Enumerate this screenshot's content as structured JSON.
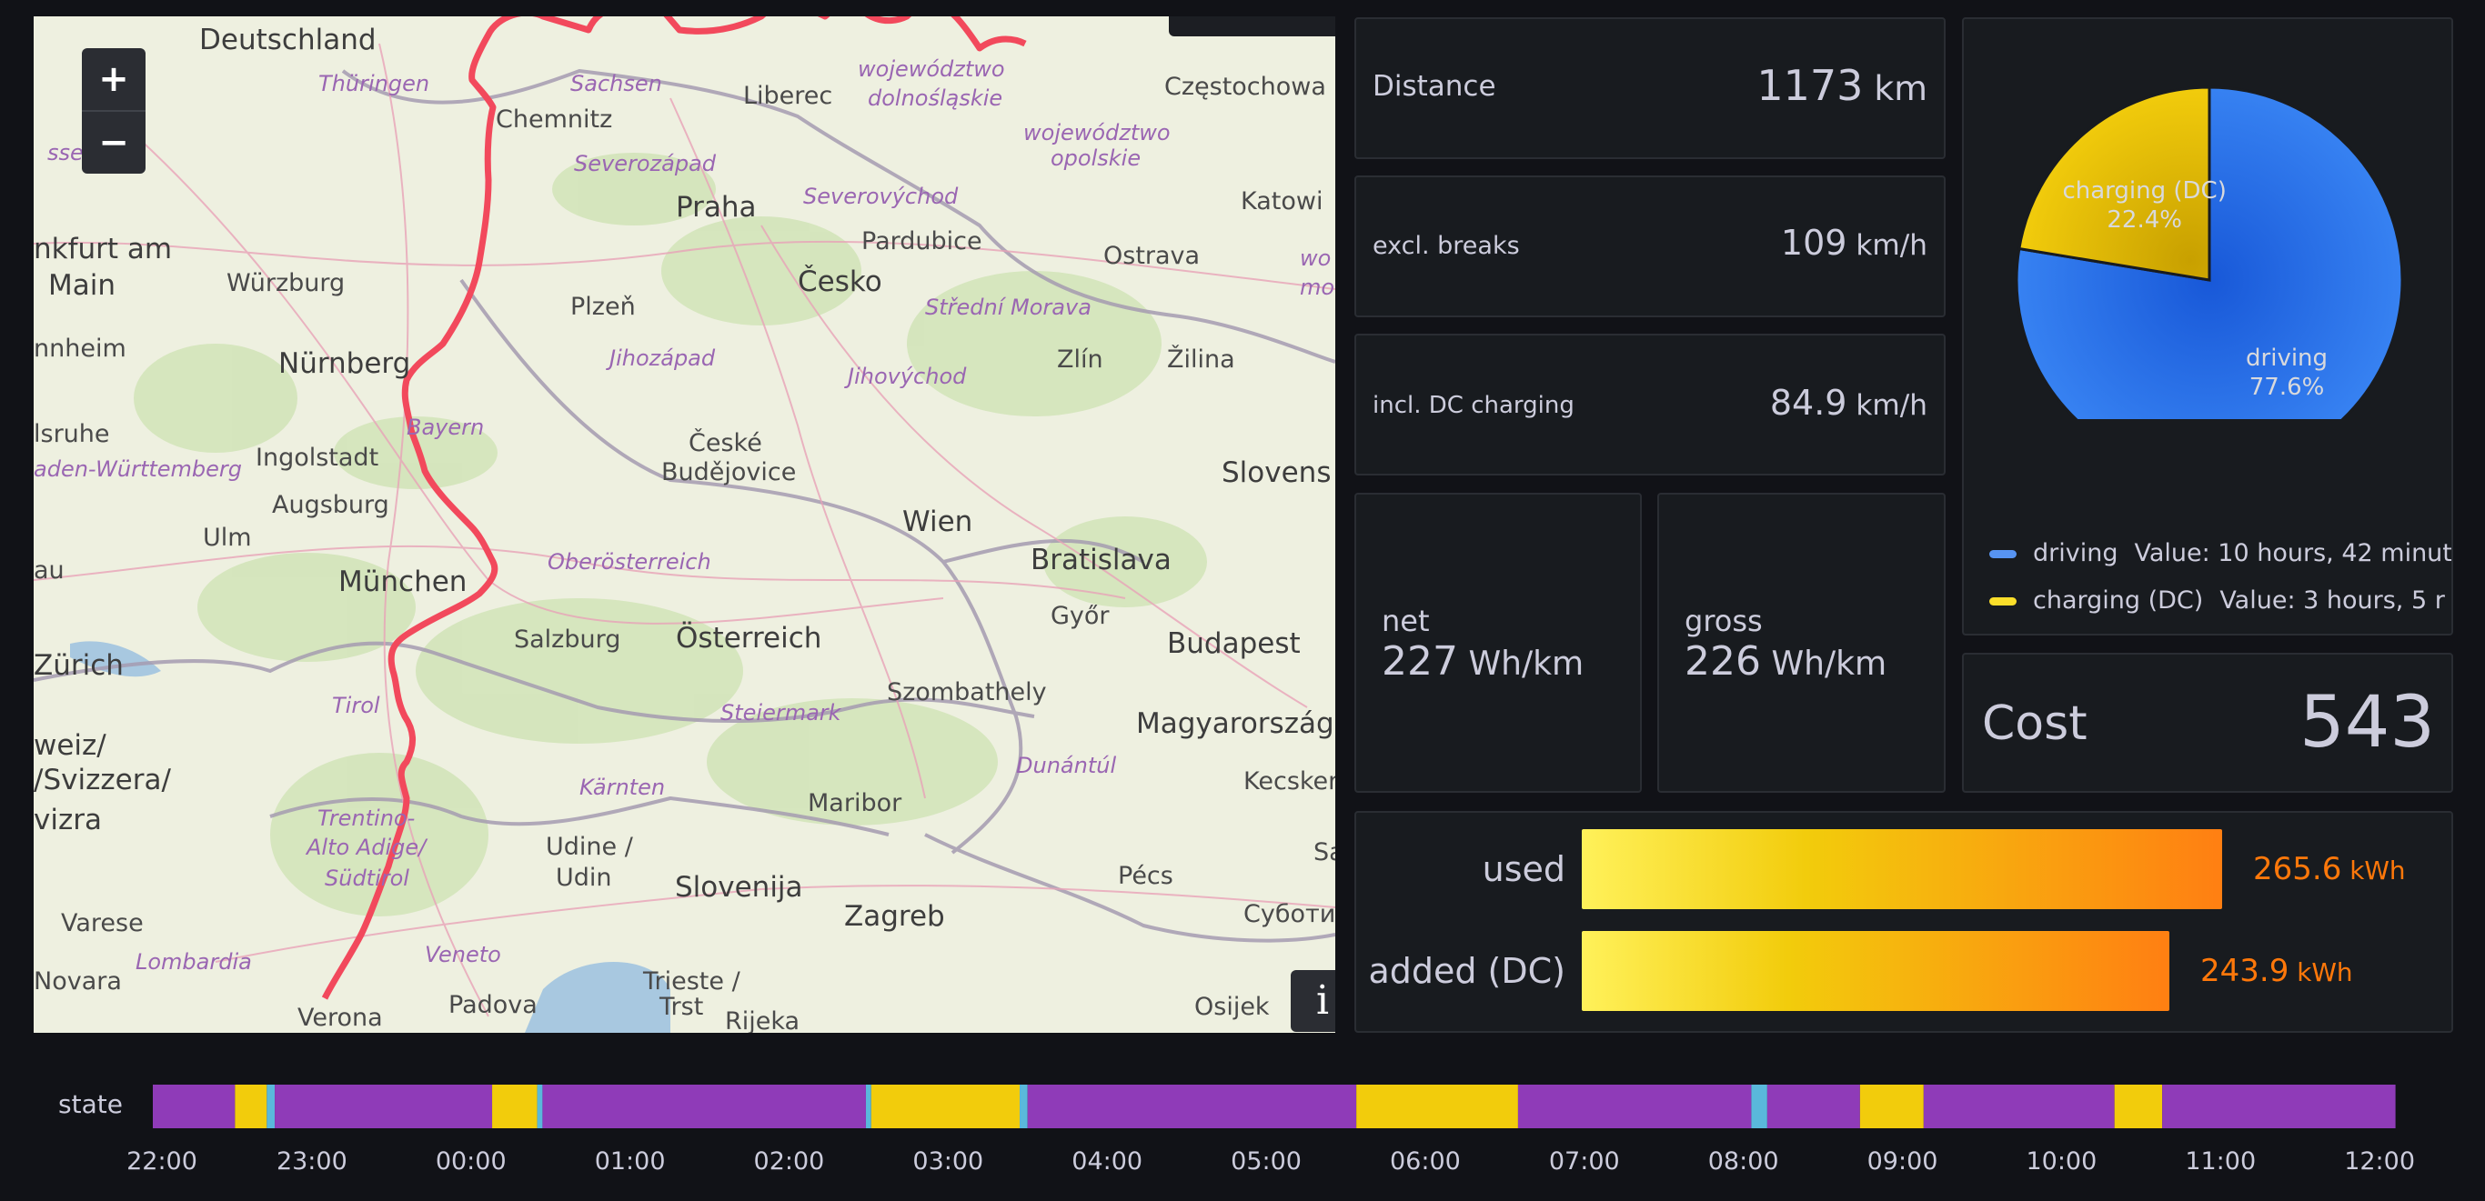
{
  "map": {
    "zoom_in": "+",
    "zoom_out": "−",
    "info": "i",
    "labels": [
      {
        "text": "Deutschland",
        "cls": "big"
      },
      {
        "text": "Thüringen",
        "cls": "region"
      },
      {
        "text": "Sachsen",
        "cls": "region"
      },
      {
        "text": "Liberec",
        "cls": ""
      },
      {
        "text": "województwo",
        "cls": "region"
      },
      {
        "text": "dolnośląskie",
        "cls": "region"
      },
      {
        "text": "Częstochowa",
        "cls": ""
      },
      {
        "text": "Chemnitz",
        "cls": ""
      },
      {
        "text": "województwo",
        "cls": "region"
      },
      {
        "text": "opolskie",
        "cls": "region"
      },
      {
        "text": "ssen",
        "cls": "region"
      },
      {
        "text": "Severozápad",
        "cls": "region"
      },
      {
        "text": "Praha",
        "cls": "big"
      },
      {
        "text": "Severovýchod",
        "cls": "region"
      },
      {
        "text": "Katowi",
        "cls": ""
      },
      {
        "text": "nkfurt am",
        "cls": "big"
      },
      {
        "text": "Main",
        "cls": "big"
      },
      {
        "text": "Pardubice",
        "cls": ""
      },
      {
        "text": "Ostrava",
        "cls": ""
      },
      {
        "text": "wo",
        "cls": "region"
      },
      {
        "text": "mo",
        "cls": "region"
      },
      {
        "text": "Würzburg",
        "cls": ""
      },
      {
        "text": "Plzeň",
        "cls": ""
      },
      {
        "text": "Česko",
        "cls": "big"
      },
      {
        "text": "Střední Morava",
        "cls": "region"
      },
      {
        "text": "nnheim",
        "cls": ""
      },
      {
        "text": "Nürnberg",
        "cls": "big"
      },
      {
        "text": "Jihozápad",
        "cls": "region"
      },
      {
        "text": "Jihovýchod",
        "cls": "region"
      },
      {
        "text": "Zlín",
        "cls": ""
      },
      {
        "text": "Žilina",
        "cls": ""
      },
      {
        "text": "Bayern",
        "cls": "region"
      },
      {
        "text": "České",
        "cls": ""
      },
      {
        "text": "Budějovice",
        "cls": ""
      },
      {
        "text": "lsruhe",
        "cls": ""
      },
      {
        "text": "Ingolstadt",
        "cls": ""
      },
      {
        "text": "aden-Württemberg",
        "cls": "region"
      },
      {
        "text": "Slovens",
        "cls": "big"
      },
      {
        "text": "Augsburg",
        "cls": ""
      },
      {
        "text": "Wien",
        "cls": "big"
      },
      {
        "text": "Ulm",
        "cls": ""
      },
      {
        "text": "Oberösterreich",
        "cls": "region"
      },
      {
        "text": "Bratislava",
        "cls": "big"
      },
      {
        "text": "München",
        "cls": "big"
      },
      {
        "text": "au",
        "cls": ""
      },
      {
        "text": "Győr",
        "cls": ""
      },
      {
        "text": "Salzburg",
        "cls": ""
      },
      {
        "text": "Österreich",
        "cls": "big"
      },
      {
        "text": "Budapest",
        "cls": "big"
      },
      {
        "text": "Zürich",
        "cls": "big"
      },
      {
        "text": "Tirol",
        "cls": "region"
      },
      {
        "text": "Szombathely",
        "cls": ""
      },
      {
        "text": "Steiermark",
        "cls": "region"
      },
      {
        "text": "Magyarország",
        "cls": "big"
      },
      {
        "text": "weiz/",
        "cls": "big"
      },
      {
        "text": "/Svizzera/",
        "cls": "big"
      },
      {
        "text": "Dunántúl",
        "cls": "region"
      },
      {
        "text": "Kecsken",
        "cls": ""
      },
      {
        "text": "Kärnten",
        "cls": "region"
      },
      {
        "text": "Trentino-",
        "cls": "region"
      },
      {
        "text": "vizra",
        "cls": "big"
      },
      {
        "text": "Alto Adige/",
        "cls": "region"
      },
      {
        "text": "Maribor",
        "cls": ""
      },
      {
        "text": "Südtirol",
        "cls": "region"
      },
      {
        "text": "Udine /",
        "cls": ""
      },
      {
        "text": "Udin",
        "cls": ""
      },
      {
        "text": "Slovenija",
        "cls": "big"
      },
      {
        "text": "Pécs",
        "cls": ""
      },
      {
        "text": "Sa",
        "cls": ""
      },
      {
        "text": "Varese",
        "cls": ""
      },
      {
        "text": "Zagreb",
        "cls": "big"
      },
      {
        "text": "Суботи",
        "cls": ""
      },
      {
        "text": "Veneto",
        "cls": "region"
      },
      {
        "text": "Lombardia",
        "cls": "region"
      },
      {
        "text": "Novara",
        "cls": ""
      },
      {
        "text": "Trieste /",
        "cls": ""
      },
      {
        "text": "Trst",
        "cls": ""
      },
      {
        "text": "Padova",
        "cls": ""
      },
      {
        "text": "Osijek",
        "cls": ""
      },
      {
        "text": "Verona",
        "cls": ""
      },
      {
        "text": "Rijeka",
        "cls": ""
      }
    ]
  },
  "stats": {
    "distance": {
      "label": "Distance",
      "value": "1173",
      "unit": " km"
    },
    "excl_breaks": {
      "label": "excl. breaks",
      "value": "109",
      "unit": " km/h"
    },
    "incl_dc": {
      "label": "incl. DC charging",
      "value": "84.9",
      "unit": " km/h"
    },
    "net": {
      "label": "net",
      "value": "227",
      "unit": " Wh/km"
    },
    "gross": {
      "label": "gross",
      "value": "226",
      "unit": " Wh/km"
    },
    "cost": {
      "label": "Cost",
      "value": "543"
    }
  },
  "pie": {
    "slices": [
      {
        "name": "driving",
        "percent": "77.6%",
        "value": 77.6,
        "color": "#1f60e0"
      },
      {
        "name": "charging (DC)",
        "percent": "22.4%",
        "value": 22.4,
        "color": "#d9ad00"
      }
    ],
    "legend": [
      {
        "name": "driving",
        "text": "Value: 10 hours, 42 minut",
        "color": "#5794f2"
      },
      {
        "name": "charging (DC)",
        "text": "Value: 3 hours, 5 r",
        "color": "#fade2a"
      }
    ]
  },
  "energy": {
    "max": 265.6,
    "rows": [
      {
        "label": "used",
        "value": 265.6,
        "display": "265.6",
        "unit": " kWh"
      },
      {
        "label": "added (DC)",
        "value": 243.9,
        "display": "243.9",
        "unit": " kWh"
      }
    ]
  },
  "timeline": {
    "label": "state",
    "start": "22:00",
    "end": "12:13",
    "colors": {
      "driving": "#8f3bb8",
      "charging": "#f2cc0c",
      "other": "#5ab8db"
    },
    "segments": [
      {
        "from": "22:00",
        "to": "22:31",
        "state": "driving"
      },
      {
        "from": "22:31",
        "to": "22:43",
        "state": "charging"
      },
      {
        "from": "22:43",
        "to": "22:46",
        "state": "other"
      },
      {
        "from": "22:46",
        "to": "00:08",
        "state": "driving"
      },
      {
        "from": "00:08",
        "to": "00:25",
        "state": "charging"
      },
      {
        "from": "00:25",
        "to": "00:27",
        "state": "other"
      },
      {
        "from": "00:27",
        "to": "02:29",
        "state": "driving"
      },
      {
        "from": "02:29",
        "to": "02:31",
        "state": "other"
      },
      {
        "from": "02:31",
        "to": "03:27",
        "state": "charging"
      },
      {
        "from": "03:27",
        "to": "03:30",
        "state": "other"
      },
      {
        "from": "03:30",
        "to": "05:34",
        "state": "driving"
      },
      {
        "from": "05:34",
        "to": "06:35",
        "state": "charging"
      },
      {
        "from": "06:35",
        "to": "08:03",
        "state": "driving"
      },
      {
        "from": "08:03",
        "to": "08:09",
        "state": "other"
      },
      {
        "from": "08:09",
        "to": "08:44",
        "state": "driving"
      },
      {
        "from": "08:44",
        "to": "09:08",
        "state": "charging"
      },
      {
        "from": "09:08",
        "to": "10:20",
        "state": "driving"
      },
      {
        "from": "10:20",
        "to": "10:38",
        "state": "charging"
      },
      {
        "from": "10:38",
        "to": "12:06",
        "state": "driving"
      }
    ],
    "ticks": [
      "22:00",
      "23:00",
      "00:00",
      "01:00",
      "02:00",
      "03:00",
      "04:00",
      "05:00",
      "06:00",
      "07:00",
      "08:00",
      "09:00",
      "10:00",
      "11:00",
      "12:00"
    ]
  }
}
